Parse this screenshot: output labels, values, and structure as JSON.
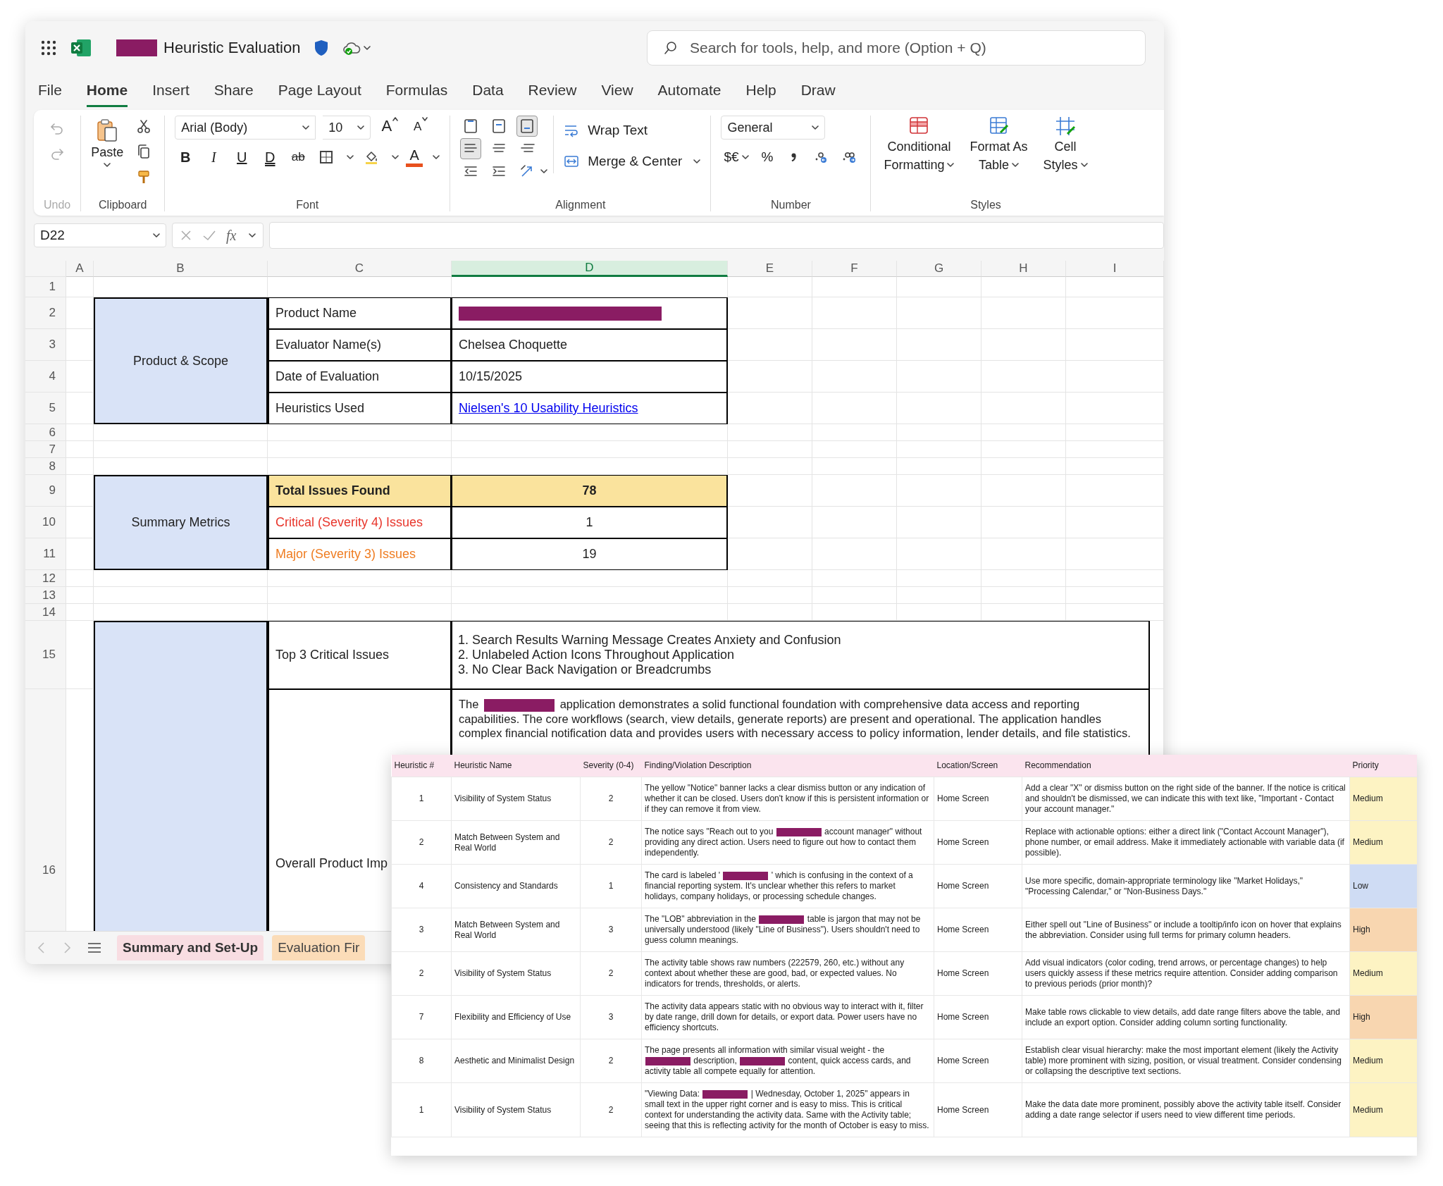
{
  "window": {
    "title_parts": [
      {
        "kind": "redacted"
      },
      {
        "kind": "text",
        "text": "Heuristic Evaluation"
      }
    ]
  },
  "search": {
    "placeholder": "Search for tools, help, and more (Option + Q)"
  },
  "menu_tabs": [
    {
      "label": "File",
      "selected": false
    },
    {
      "label": "Home",
      "selected": true
    },
    {
      "label": "Insert",
      "selected": false
    },
    {
      "label": "Share",
      "selected": false
    },
    {
      "label": "Page Layout",
      "selected": false
    },
    {
      "label": "Formulas",
      "selected": false
    },
    {
      "label": "Data",
      "selected": false
    },
    {
      "label": "Review",
      "selected": false
    },
    {
      "label": "View",
      "selected": false
    },
    {
      "label": "Automate",
      "selected": false
    },
    {
      "label": "Help",
      "selected": false
    },
    {
      "label": "Draw",
      "selected": false
    }
  ],
  "ribbon": {
    "undo": {
      "label": "Undo"
    },
    "clipboard": {
      "paste": "Paste",
      "label": "Clipboard"
    },
    "font": {
      "font_name": "Arial (Body)",
      "font_size": "10",
      "grow": "A",
      "shrink": "A",
      "format_buttons": [
        {
          "kind": "bold",
          "label": "B"
        },
        {
          "kind": "italic",
          "label": "I"
        },
        {
          "kind": "underline",
          "label": "U"
        },
        {
          "kind": "double-underline",
          "label": "D"
        },
        {
          "kind": "strikethrough",
          "label": "ab"
        }
      ],
      "font_color": "A",
      "label": "Font"
    },
    "alignment": {
      "vertical": [
        {
          "kind": "top",
          "selected": false
        },
        {
          "kind": "middle",
          "selected": false
        },
        {
          "kind": "bottom",
          "selected": true
        }
      ],
      "horizontal": [
        {
          "kind": "left",
          "selected": true
        },
        {
          "kind": "center",
          "selected": false
        },
        {
          "kind": "right",
          "selected": false
        }
      ],
      "wrap_text": "Wrap Text",
      "merge_center": "Merge & Center",
      "label": "Alignment"
    },
    "number": {
      "format": "General",
      "currency": "$€",
      "percent": "%",
      "label": "Number"
    },
    "styles": {
      "buttons": [
        {
          "kind": "conditional",
          "lines": [
            "Conditional",
            "Formatting"
          ]
        },
        {
          "kind": "table",
          "lines": [
            "Format As",
            "Table"
          ]
        },
        {
          "kind": "cell",
          "lines": [
            "Cell",
            "Styles"
          ]
        }
      ],
      "label": "Styles"
    }
  },
  "formula_bar": {
    "cell_ref": "D22",
    "function_label": "fx"
  },
  "sheet": {
    "columns": [
      {
        "label": "A",
        "selected": false
      },
      {
        "label": "B",
        "selected": false
      },
      {
        "label": "C",
        "selected": false
      },
      {
        "label": "D",
        "selected": true
      },
      {
        "label": "E",
        "selected": false
      },
      {
        "label": "F",
        "selected": false
      },
      {
        "label": "G",
        "selected": false
      },
      {
        "label": "H",
        "selected": false
      },
      {
        "label": "I",
        "selected": false
      }
    ],
    "row_numbers": [
      "1",
      "2",
      "3",
      "4",
      "5",
      "6",
      "7",
      "8",
      "9",
      "10",
      "11",
      "12",
      "13",
      "14",
      "15",
      "16"
    ],
    "sections": [
      {
        "label": "Product & Scope",
        "rows": [
          {
            "label": "Product Name",
            "highlighted": false,
            "kind": "redacted"
          },
          {
            "label": "Evaluator Name(s)",
            "highlighted": false,
            "kind": "text",
            "value": "Chelsea Choquette"
          },
          {
            "label": "Date of Evaluation",
            "highlighted": false,
            "kind": "text",
            "value": "10/15/2025"
          },
          {
            "label": "Heuristics Used",
            "highlighted": false,
            "kind": "link",
            "value": "Nielsen's 10 Usability Heuristics"
          }
        ]
      },
      {
        "label": "Summary Metrics",
        "rows": [
          {
            "label": "Total Issues Found",
            "highlighted": true,
            "kind": "number",
            "value": "78"
          },
          {
            "label": "Critical (Severity 4) Issues",
            "color": "#e8352b",
            "highlighted": false,
            "kind": "number",
            "value": "1"
          },
          {
            "label": "Major (Severity 3) Issues",
            "color": "#ef7d22",
            "highlighted": false,
            "kind": "number",
            "value": "19"
          }
        ]
      },
      {
        "rows": [
          {
            "label": "Top 3 Critical Issues",
            "highlighted": false,
            "kind": "list",
            "items": [
              "1. Search Results Warning Message Creates Anxiety and Confusion",
              "2. Unlabeled Action Icons Throughout Application",
              "3. No Clear Back Navigation or Breadcrumbs"
            ]
          },
          {
            "label": "Overall Product Imp",
            "highlighted": false,
            "kind": "paragraph",
            "parts": [
              {
                "kind": "text",
                "text": "The"
              },
              {
                "kind": "redacted"
              },
              {
                "kind": "text",
                "text": "application demonstrates a solid functional foundation with comprehensive data access and reporting capabilities. The core workflows (search, view details, generate reports) are present and operational. The application handles complex financial notification data and provides users with necessary access to policy information, lender details, and file statistics."
              }
            ]
          }
        ]
      }
    ]
  },
  "sheet_tabs": [
    {
      "label": "Summary and Set-Up",
      "selected": true,
      "color": "#f8dde2"
    },
    {
      "label": "Evaluation Fir",
      "selected": false,
      "color": "#fbdcb8"
    }
  ],
  "findings_table": {
    "columns": [
      "Heuristic #",
      "Heuristic Name",
      "Severity (0-4)",
      "Finding/Violation Description",
      "Location/Screen",
      "Recommendation",
      "Priority"
    ],
    "rows": [
      {
        "number": "1",
        "name": "Visibility of System Status",
        "severity": "2",
        "description": [
          {
            "kind": "text",
            "text": "The yellow \"Notice\" banner lacks a clear dismiss button or any indication of whether it can be closed. Users don't know if this is persistent information or if they can remove it from view."
          }
        ],
        "location": "Home Screen",
        "recommendation": "Add a clear \"X\" or dismiss button on the right side of the banner. If the notice is critical and shouldn't be dismissed, we can indicate this with text like, \"Important - Contact your account manager.\"",
        "priority": "Medium",
        "color": "#fdf3c3"
      },
      {
        "number": "2",
        "name": "Match Between System and Real World",
        "severity": "2",
        "description": [
          {
            "kind": "text",
            "text": "The notice says \"Reach out to you"
          },
          {
            "kind": "redacted"
          },
          {
            "kind": "text",
            "text": "account manager\" without providing any direct action. Users need to figure out how to contact them independently."
          }
        ],
        "location": "Home Screen",
        "recommendation": "Replace with actionable options: either a direct link (\"Contact Account Manager\"), phone number, or email address. Make it immediately actionable with variable data (if possible).",
        "priority": "Medium",
        "color": "#fdf3c3"
      },
      {
        "number": "4",
        "name": "Consistency and Standards",
        "severity": "1",
        "description": [
          {
            "kind": "text",
            "text": "The card is labeled '"
          },
          {
            "kind": "redacted"
          },
          {
            "kind": "text",
            "text": "' which is confusing in the context of a financial reporting system. It's unclear whether this refers to market holidays, company holidays, or processing schedule changes."
          }
        ],
        "location": "Home Screen",
        "recommendation": "Use more specific, domain-appropriate terminology like \"Market Holidays,\" \"Processing Calendar,\" or \"Non-Business Days.\"",
        "priority": "Low",
        "color": "#cfdcf4"
      },
      {
        "number": "3",
        "name": "Match Between System and Real World",
        "severity": "3",
        "description": [
          {
            "kind": "text",
            "text": "The \"LOB\" abbreviation in the"
          },
          {
            "kind": "redacted"
          },
          {
            "kind": "text",
            "text": "table is jargon that may not be universally understood (likely \"Line of Business\"). Users shouldn't need to guess column meanings."
          }
        ],
        "location": "Home Screen",
        "recommendation": "Either spell out \"Line of Business\" or include a tooltip/info icon on hover that explains the abbreviation. Consider using full terms for primary column headers.",
        "priority": "High",
        "color": "#f8d6b0"
      },
      {
        "number": "2",
        "name": "Visibility of System Status",
        "severity": "2",
        "description": [
          {
            "kind": "text",
            "text": "The activity table shows raw numbers (222579, 260, etc.) without any context about whether these are good, bad, or expected values. No indicators for trends, thresholds, or alerts."
          }
        ],
        "location": "Home Screen",
        "recommendation": "Add visual indicators (color coding, trend arrows, or percentage changes) to help users quickly assess if these metrics require attention. Consider adding comparison to previous periods (prior month)?",
        "priority": "Medium",
        "color": "#fdf3c3"
      },
      {
        "number": "7",
        "name": "Flexibility and Efficiency of Use",
        "severity": "3",
        "description": [
          {
            "kind": "text",
            "text": "The activity data appears static with no obvious way to interact with it, filter by date range, drill down for details, or export data. Power users have no efficiency shortcuts."
          }
        ],
        "location": "Home Screen",
        "recommendation": "Make table rows clickable to view details, add date range filters above the table, and include an export option. Consider adding column sorting functionality.",
        "priority": "High",
        "color": "#f8d6b0"
      },
      {
        "number": "8",
        "name": "Aesthetic and Minimalist Design",
        "severity": "2",
        "description": [
          {
            "kind": "text",
            "text": "The page presents all information with similar visual weight - the"
          },
          {
            "kind": "redacted"
          },
          {
            "kind": "text",
            "text": "description,"
          },
          {
            "kind": "redacted"
          },
          {
            "kind": "text",
            "text": "content, quick access cards, and activity table all compete equally for attention."
          }
        ],
        "location": "Home Screen",
        "recommendation": "Establish clear visual hierarchy: make the most important element (likely the Activity table) more prominent with sizing, position, or visual treatment. Consider condensing or collapsing the descriptive text sections.",
        "priority": "Medium",
        "color": "#fdf3c3"
      },
      {
        "number": "1",
        "name": "Visibility of System Status",
        "severity": "2",
        "description": [
          {
            "kind": "text",
            "text": "\"Viewing Data:"
          },
          {
            "kind": "redacted"
          },
          {
            "kind": "text",
            "text": "| Wednesday, October 1, 2025\" appears in small text in the upper right corner and is easy to miss. This is critical context for understanding the activity data. Same with the Activity table; seeing that this is reflecting activity for the month of October is easy to miss."
          }
        ],
        "location": "Home Screen",
        "recommendation": "Make the data date more prominent, possibly above the activity table itself. Consider adding a date range selector if users need to view different time periods.",
        "priority": "Medium",
        "color": "#fdf3c3"
      }
    ]
  }
}
